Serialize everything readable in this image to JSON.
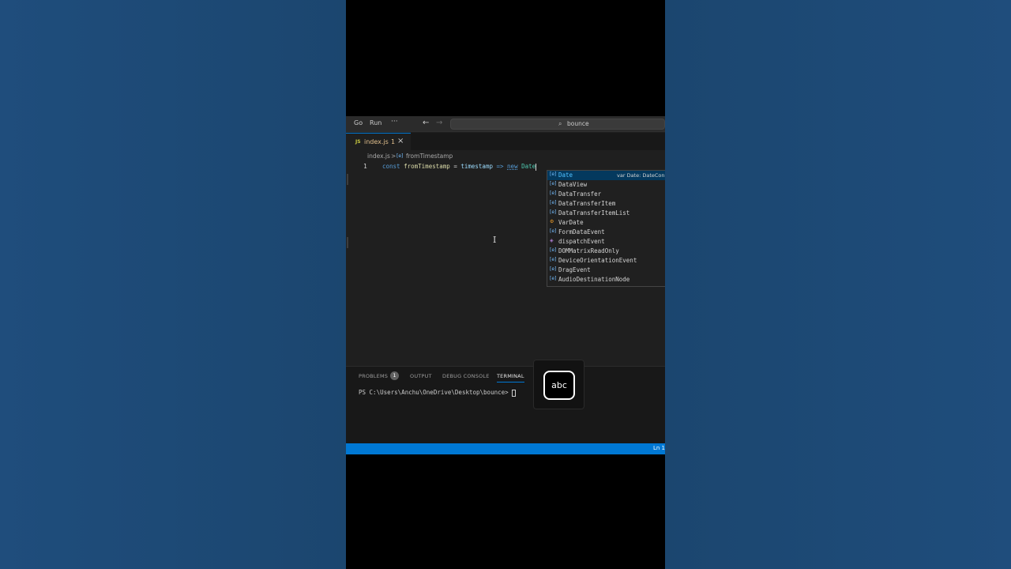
{
  "titlebar": {
    "menu_go": "Go",
    "menu_run": "Run",
    "menu_more": "···",
    "nav_back": "←",
    "nav_forward": "→",
    "search_icon": "⌕",
    "search_text": "bounce"
  },
  "tab": {
    "icon": "JS",
    "name": "index.js",
    "problems": "1",
    "close": "×"
  },
  "breadcrumb": {
    "file": "index.js",
    "separator": ">",
    "symbol_icon": "[e]",
    "symbol": "fromTimestamp"
  },
  "editor": {
    "line_number": "1",
    "tokens": {
      "kw_const": "const",
      "name": "fromTimestamp",
      "eq": "=",
      "param": "timestamp",
      "arrow": "=>",
      "kw_new": "new",
      "cls": "Date"
    }
  },
  "suggest": {
    "items": [
      {
        "icon": "[e]",
        "label": "Date",
        "detail": "var Date: DateConstructor"
      },
      {
        "icon": "[e]",
        "label": "DataView"
      },
      {
        "icon": "[e]",
        "label": "DataTransfer"
      },
      {
        "icon": "[e]",
        "label": "DataTransferItem"
      },
      {
        "icon": "[e]",
        "label": "DataTransferItemList"
      },
      {
        "icon": "⚙",
        "label": "VarDate"
      },
      {
        "icon": "[e]",
        "label": "FormDataEvent"
      },
      {
        "icon": "◈",
        "label": "dispatchEvent"
      },
      {
        "icon": "[e]",
        "label": "DOMMatrixReadOnly"
      },
      {
        "icon": "[e]",
        "label": "DeviceOrientationEvent"
      },
      {
        "icon": "[e]",
        "label": "DragEvent"
      },
      {
        "icon": "[e]",
        "label": "AudioDestinationNode"
      }
    ]
  },
  "panel": {
    "tabs": {
      "problems": "PROBLEMS",
      "problems_count": "1",
      "output": "OUTPUT",
      "debug": "DEBUG CONSOLE",
      "terminal": "TERMINAL"
    },
    "terminal_prompt": "PS C:\\Users\\Anchu\\OneDrive\\Desktop\\bounce> "
  },
  "overlay": {
    "abc": "abc"
  },
  "status": {
    "position": "Ln 1"
  },
  "colors": {
    "accent": "#0078d4",
    "background": "#1f4d7c",
    "editor_bg": "#1f1f1f"
  }
}
